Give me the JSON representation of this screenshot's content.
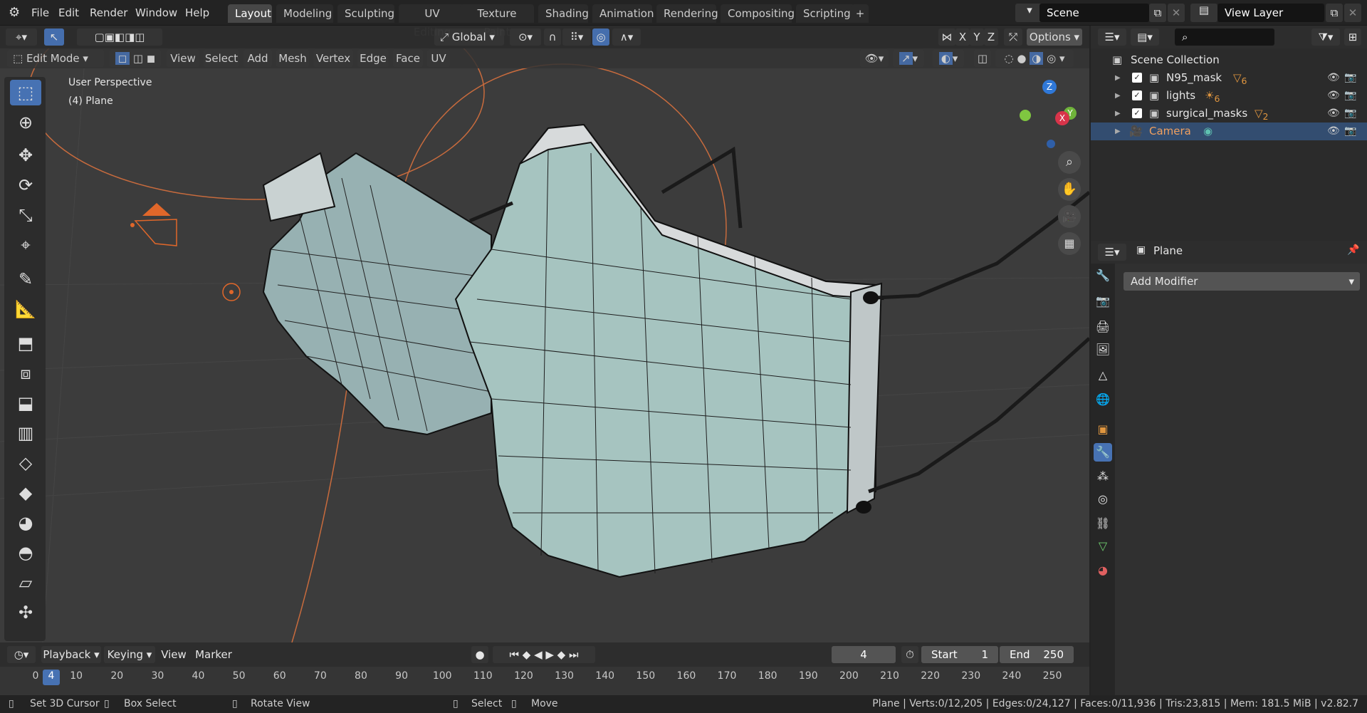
{
  "menus": [
    "File",
    "Edit",
    "Render",
    "Window",
    "Help"
  ],
  "workspaces": [
    "Layout",
    "Modeling",
    "Sculpting",
    "UV Editing",
    "Texture Paint",
    "Shading",
    "Animation",
    "Rendering",
    "Compositing",
    "Scripting"
  ],
  "add_workspace": "+",
  "scene": {
    "label": "Scene"
  },
  "view_layer": {
    "label": "View Layer"
  },
  "header": {
    "orientation": "Global",
    "axes": [
      "X",
      "Y",
      "Z"
    ],
    "options": "Options"
  },
  "viewport_header": {
    "mode": "Edit Mode",
    "menus": [
      "View",
      "Select",
      "Add",
      "Mesh",
      "Vertex",
      "Edge",
      "Face",
      "UV"
    ]
  },
  "viewport": {
    "perspective": "User Perspective",
    "object": "(4) Plane"
  },
  "gizmo": {
    "x": "X",
    "y": "Y",
    "z": "Z"
  },
  "outliner": {
    "root": "Scene Collection",
    "items": [
      {
        "name": "N95_mask",
        "badge": "6"
      },
      {
        "name": "lights",
        "badge": "6"
      },
      {
        "name": "surgical_masks",
        "badge": "2"
      },
      {
        "name": "Camera",
        "badge": ""
      }
    ]
  },
  "properties": {
    "object_name": "Plane",
    "add_modifier": "Add Modifier"
  },
  "timeline": {
    "menus": [
      "Playback",
      "Keying",
      "View",
      "Marker"
    ],
    "current_frame": "4",
    "start_label": "Start",
    "start": "1",
    "end_label": "End",
    "end": "250",
    "ticks": [
      "0",
      "10",
      "20",
      "30",
      "40",
      "50",
      "60",
      "70",
      "80",
      "90",
      "100",
      "110",
      "120",
      "130",
      "140",
      "150",
      "160",
      "170",
      "180",
      "190",
      "200",
      "210",
      "220",
      "230",
      "240",
      "250"
    ]
  },
  "statusbar": {
    "hints": [
      "Set 3D Cursor",
      "Box Select",
      "Rotate View",
      "Select",
      "Move"
    ],
    "stats": "Plane | Verts:0/12,205 | Edges:0/24,127 | Faces:0/11,936 | Tris:23,815 | Mem: 181.5 MiB | v2.82.7"
  },
  "colors": {
    "accent": "#4772b3",
    "mesh_fill": "#a6c4c0",
    "edge": "#111111",
    "light": "#e0672a"
  }
}
